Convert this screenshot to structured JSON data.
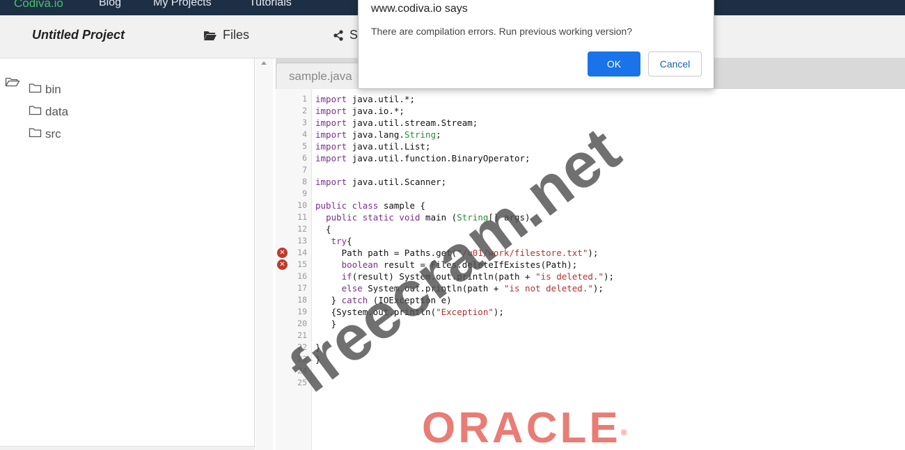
{
  "nav": {
    "brand": "Codiva.io",
    "links": [
      "Blog",
      "My Projects",
      "Tutorials"
    ]
  },
  "project": {
    "title": "Untitled Project",
    "files_label": "Files",
    "share_label": "S"
  },
  "file_tree": [
    {
      "name": "bin",
      "icon": "folder-icon"
    },
    {
      "name": "data",
      "icon": "folder-icon"
    },
    {
      "name": "src",
      "icon": "folder-icon"
    }
  ],
  "editor": {
    "tab_label": "sample.java",
    "error_lines": [
      14,
      15
    ],
    "lines": [
      {
        "n": "1",
        "html": "<span class='kw'>import</span> java.util.*;"
      },
      {
        "n": "2",
        "html": "<span class='kw'>import</span> java.io.*;"
      },
      {
        "n": "3",
        "html": "<span class='kw'>import</span> java.util.stream.Stream;"
      },
      {
        "n": "4",
        "html": "<span class='kw'>import</span> java.lang.<span class='ty'>String</span>;"
      },
      {
        "n": "5",
        "html": "<span class='kw'>import</span> java.util.List;"
      },
      {
        "n": "6",
        "html": "<span class='kw'>import</span> java.util.function.BinaryOperator;"
      },
      {
        "n": "7",
        "html": ""
      },
      {
        "n": "8",
        "html": "<span class='kw'>import</span> java.util.Scanner;"
      },
      {
        "n": "9",
        "html": ""
      },
      {
        "n": "10",
        "html": "<span class='kw'>public class</span> sample {"
      },
      {
        "n": "11",
        "html": "  <span class='kw'>public static void</span> main (<span class='ty'>String</span>[] args)"
      },
      {
        "n": "12",
        "html": "  {"
      },
      {
        "n": "13",
        "html": "   <span class='kw'>try</span>{"
      },
      {
        "n": "14",
        "html": "     Path path = Paths.get(<span class='st'>\"/u01/work/filestore.txt\"</span>);"
      },
      {
        "n": "15",
        "html": "     <span class='kw'>boolean</span> result = Files.deleteIfExistes(Path);"
      },
      {
        "n": "16",
        "html": "     <span class='kw'>if</span>(result) System.out.println(path + <span class='st'>\"is deleted.\"</span>);"
      },
      {
        "n": "17",
        "html": "     <span class='kw'>else</span> System.out.println(path + <span class='st'>\"is not deleted.\"</span>);"
      },
      {
        "n": "18",
        "html": "   } <span class='kw'>catch</span> (IOException e)"
      },
      {
        "n": "19",
        "html": "   {System.out.println(<span class='st'>\"Exception\"</span>);"
      },
      {
        "n": "20",
        "html": "   }"
      },
      {
        "n": "21",
        "html": ""
      },
      {
        "n": "22",
        "html": "}"
      },
      {
        "n": "23",
        "html": "}"
      },
      {
        "n": "24",
        "html": ""
      },
      {
        "n": "25",
        "html": ""
      }
    ]
  },
  "dialog": {
    "title": "www.codiva.io says",
    "message": "There are compilation errors. Run previous working version?",
    "ok_label": "OK",
    "cancel_label": "Cancel"
  },
  "watermark": "freecram.net",
  "logo": {
    "text": "ORACLE",
    "mark": "®",
    "color": "#e97c74"
  }
}
